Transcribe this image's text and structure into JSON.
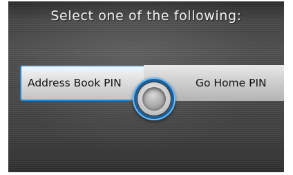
{
  "dialog": {
    "prompt": "Select one of the following:",
    "options": [
      {
        "label": "Address Book PIN",
        "selected": true
      },
      {
        "label": "Go Home PIN",
        "selected": false
      }
    ]
  },
  "colors": {
    "highlight": "#2b86c9",
    "background": "#4a4a4a",
    "text_light": "#f2f2f2"
  },
  "icons": {
    "knob": "interface-knob-icon"
  }
}
